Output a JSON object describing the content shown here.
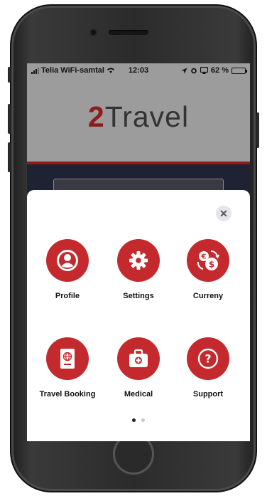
{
  "status_bar": {
    "carrier": "Telia WiFi-samtal",
    "time": "12:03",
    "battery": "62 %",
    "battery_level": 0.62
  },
  "header": {
    "logo_prefix": "2",
    "logo_text": "Travel"
  },
  "menu": {
    "close_label": "✕",
    "items": [
      {
        "label": "Profile",
        "icon": "user-icon"
      },
      {
        "label": "Settings",
        "icon": "gear-icon"
      },
      {
        "label": "Curreny",
        "icon": "currency-exchange-icon"
      },
      {
        "label": "Travel Booking",
        "icon": "passport-icon"
      },
      {
        "label": "Medical",
        "icon": "medical-kit-icon"
      },
      {
        "label": "Support",
        "icon": "question-icon"
      }
    ],
    "page_count": 2,
    "active_page": 1
  },
  "colors": {
    "accent": "#c42a2d",
    "brand_dark_red": "#8f1c1c",
    "header_gray": "#9c9c9c"
  }
}
